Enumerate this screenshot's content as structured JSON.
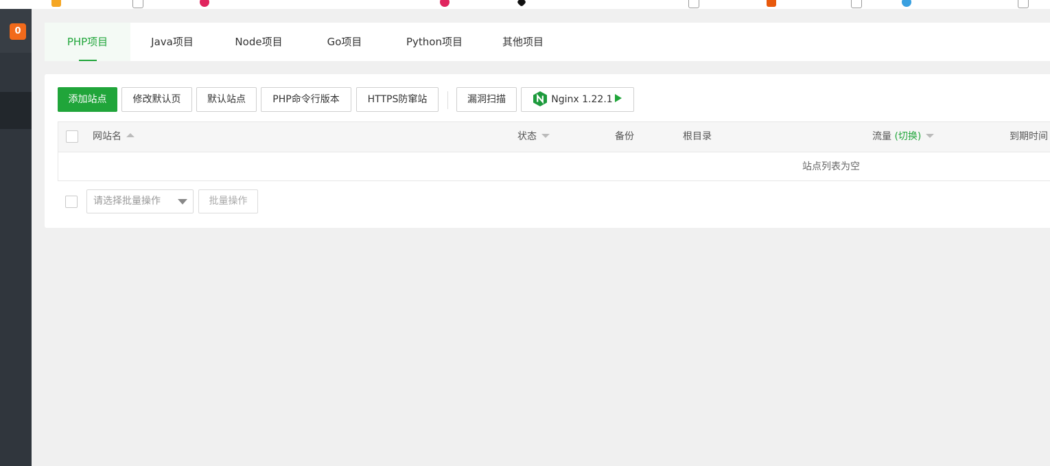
{
  "sidebar": {
    "notification_count": "0"
  },
  "tabs": [
    {
      "label": "PHP项目",
      "active": true
    },
    {
      "label": "Java项目",
      "active": false
    },
    {
      "label": "Node项目",
      "active": false
    },
    {
      "label": "Go项目",
      "active": false
    },
    {
      "label": "Python项目",
      "active": false
    },
    {
      "label": "其他项目",
      "active": false
    }
  ],
  "toolbar": {
    "add_site": "添加站点",
    "edit_default_page": "修改默认页",
    "default_site": "默认站点",
    "php_cli_version": "PHP命令行版本",
    "https_anti_spoof": "HTTPS防窜站",
    "vuln_scan": "漏洞扫描",
    "nginx_label": "Nginx 1.22.1"
  },
  "table": {
    "columns": {
      "site_name": "网站名",
      "status": "状态",
      "backup": "备份",
      "root_dir": "根目录",
      "traffic": "流量",
      "traffic_toggle": "(切换)",
      "expire": "到期时间"
    },
    "empty_text": "站点列表为空"
  },
  "batch": {
    "placeholder": "请选择批量操作",
    "button": "批量操作"
  },
  "colors": {
    "accent": "#20a53a",
    "sidebar": "#30363d",
    "badge": "#f26a1b"
  }
}
